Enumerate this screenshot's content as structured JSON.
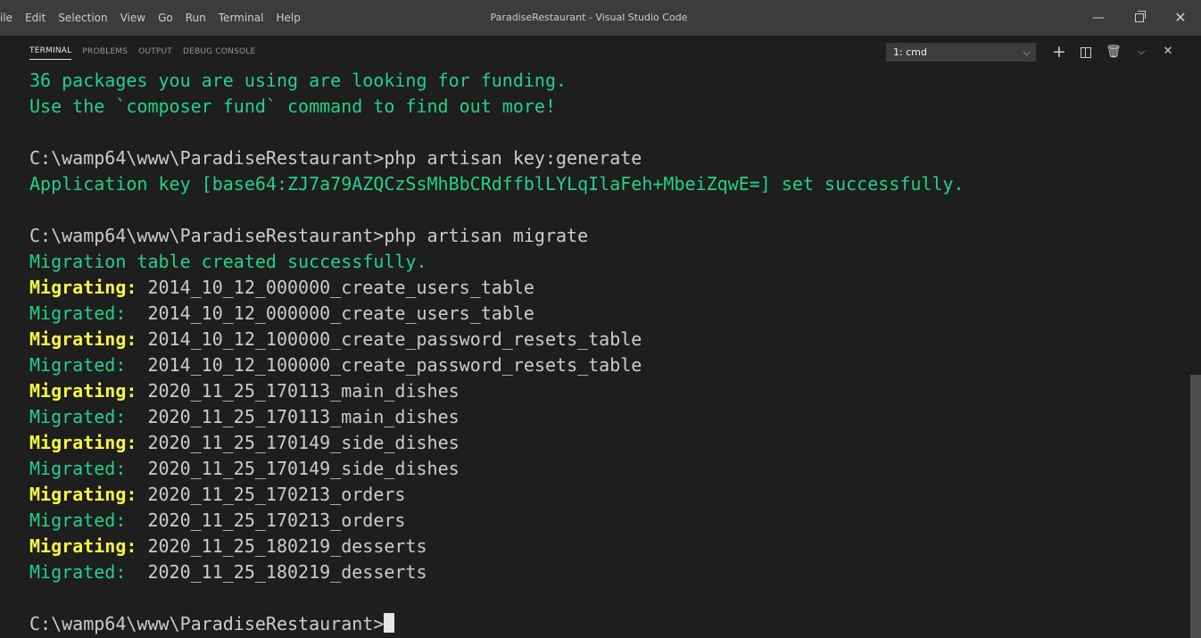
{
  "window": {
    "menu": [
      "ile",
      "Edit",
      "Selection",
      "View",
      "Go",
      "Run",
      "Terminal",
      "Help"
    ],
    "title": "ParadiseRestaurant - Visual Studio Code",
    "controls": {
      "minimize": "—",
      "close": "✕"
    }
  },
  "panel": {
    "tabs": [
      "TERMINAL",
      "PROBLEMS",
      "OUTPUT",
      "DEBUG CONSOLE"
    ],
    "active_tab": "TERMINAL",
    "terminal_select": "1: cmd",
    "icons": [
      "plus-icon",
      "split-icon",
      "trash-icon",
      "chevron-down-icon",
      "close-icon"
    ]
  },
  "terminal": {
    "lines": [
      {
        "t": "green",
        "text": "36 packages you are using are looking for funding."
      },
      {
        "t": "green",
        "text": "Use the `composer fund` command to find out more!"
      },
      {
        "t": "blank",
        "text": ""
      },
      {
        "t": "prompt",
        "text": "C:\\wamp64\\www\\ParadiseRestaurant>php artisan key:generate"
      },
      {
        "t": "green",
        "text": "Application key [base64:ZJ7a79AZQCzSsMhBbCRdffblLYLqIlaFeh+MbeiZqwE=] set successfully."
      },
      {
        "t": "blank",
        "text": ""
      },
      {
        "t": "prompt",
        "text": "C:\\wamp64\\www\\ParadiseRestaurant>php artisan migrate"
      },
      {
        "t": "green",
        "text": "Migration table created successfully."
      },
      {
        "t": "migrating",
        "label": "Migrating:",
        "text": " 2014_10_12_000000_create_users_table"
      },
      {
        "t": "migrated",
        "label": "Migrated: ",
        "text": " 2014_10_12_000000_create_users_table"
      },
      {
        "t": "migrating",
        "label": "Migrating:",
        "text": " 2014_10_12_100000_create_password_resets_table"
      },
      {
        "t": "migrated",
        "label": "Migrated: ",
        "text": " 2014_10_12_100000_create_password_resets_table"
      },
      {
        "t": "migrating",
        "label": "Migrating:",
        "text": " 2020_11_25_170113_main_dishes"
      },
      {
        "t": "migrated",
        "label": "Migrated: ",
        "text": " 2020_11_25_170113_main_dishes"
      },
      {
        "t": "migrating",
        "label": "Migrating:",
        "text": " 2020_11_25_170149_side_dishes"
      },
      {
        "t": "migrated",
        "label": "Migrated: ",
        "text": " 2020_11_25_170149_side_dishes"
      },
      {
        "t": "migrating",
        "label": "Migrating:",
        "text": " 2020_11_25_170213_orders"
      },
      {
        "t": "migrated",
        "label": "Migrated: ",
        "text": " 2020_11_25_170213_orders"
      },
      {
        "t": "migrating",
        "label": "Migrating:",
        "text": " 2020_11_25_180219_desserts"
      },
      {
        "t": "migrated",
        "label": "Migrated: ",
        "text": " 2020_11_25_180219_desserts"
      },
      {
        "t": "blank",
        "text": ""
      },
      {
        "t": "cursor",
        "text": "C:\\wamp64\\www\\ParadiseRestaurant>"
      }
    ]
  }
}
